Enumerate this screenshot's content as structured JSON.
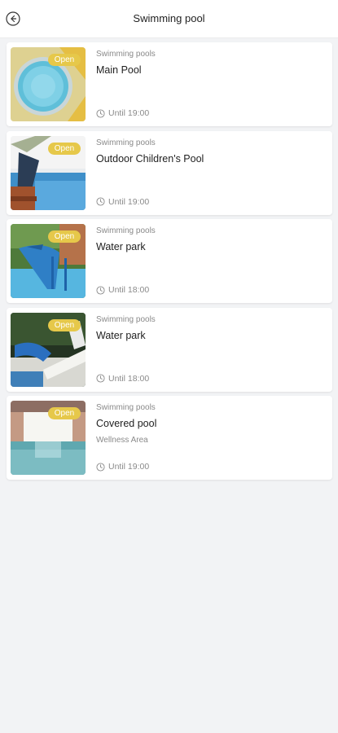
{
  "header": {
    "title": "Swimming pool",
    "back_icon": "arrow-left-circle-icon"
  },
  "items": [
    {
      "category": "Swimming pools",
      "name": "Main Pool",
      "sub": "",
      "status": "Open",
      "hours": "Until 19:00"
    },
    {
      "category": "Swimming pools",
      "name": "Outdoor Children's Pool",
      "sub": "",
      "status": "Open",
      "hours": "Until 19:00"
    },
    {
      "category": "Swimming pools",
      "name": "Water park",
      "sub": "",
      "status": "Open",
      "hours": "Until 18:00"
    },
    {
      "category": "Swimming pools",
      "name": "Water park",
      "sub": "",
      "status": "Open",
      "hours": "Until 18:00"
    },
    {
      "category": "Swimming pools",
      "name": "Covered pool",
      "sub": "Wellness Area",
      "status": "Open",
      "hours": "Until 19:00"
    }
  ],
  "colors": {
    "badge": "#e6c84a",
    "background": "#f2f3f5",
    "card": "#ffffff"
  }
}
